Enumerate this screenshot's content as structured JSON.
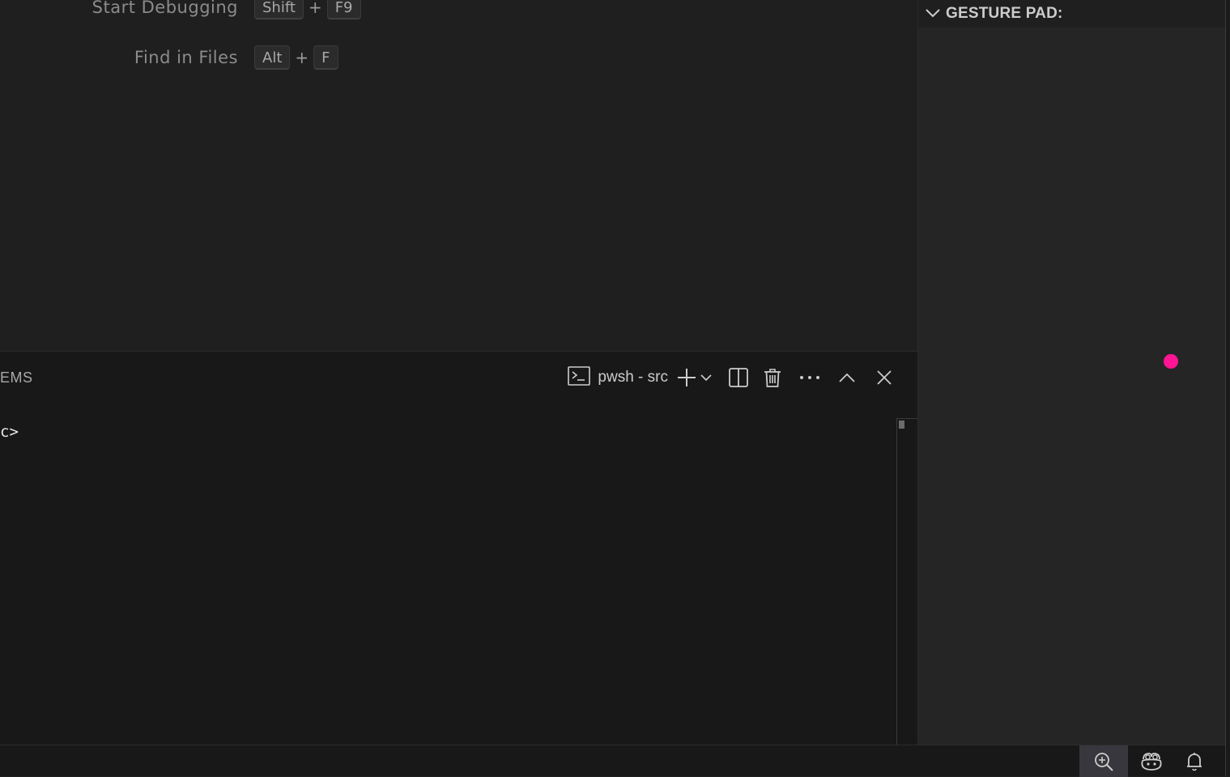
{
  "editor": {
    "shortcuts": [
      {
        "label": "Start Debugging",
        "keys": [
          "Shift",
          "F9"
        ]
      },
      {
        "label": "Find in Files",
        "keys": [
          "Alt",
          "F"
        ]
      }
    ],
    "plus": "+"
  },
  "panel": {
    "tab_label": "EMS",
    "terminal_name": "pwsh - src",
    "prompt": "c>",
    "icons": {
      "terminal": "terminal-icon",
      "add": "plus-icon",
      "dropdown": "chevron-down-icon",
      "split": "split-icon",
      "kill": "trash-icon",
      "more": "ellipsis-icon",
      "maximize": "chevron-up-icon",
      "close": "close-icon"
    }
  },
  "sidebar": {
    "title": "GESTURE PAD:",
    "dot_color": "#ff1493"
  },
  "statusbar": {
    "icons": [
      "zoom-in-icon",
      "copilot-icon",
      "bell-icon"
    ]
  },
  "colors": {
    "background": "#1f1f1f",
    "panel": "#181818",
    "sidebar": "#252526",
    "accent_dot": "#ff1493"
  }
}
